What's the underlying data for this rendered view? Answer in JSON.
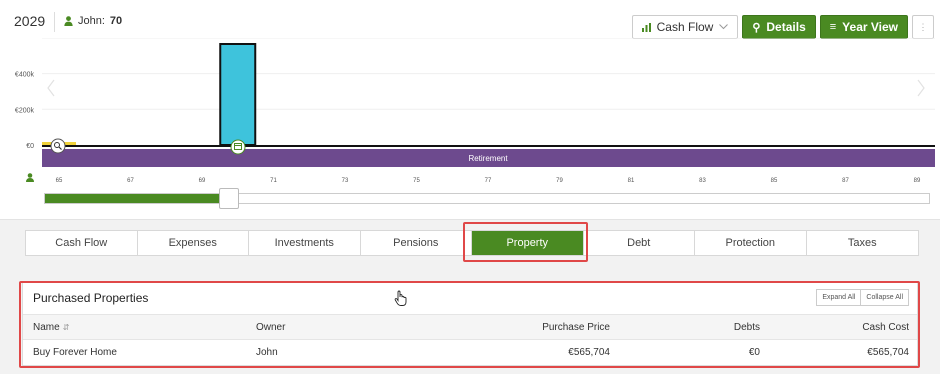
{
  "header": {
    "year": "2029",
    "person": {
      "name": "John:",
      "age": "70"
    }
  },
  "toolbar": {
    "view_select": "Cash Flow",
    "details": "Details",
    "year_view": "Year View",
    "more": "⋮"
  },
  "chart_data": {
    "type": "bar",
    "y_ticks": [
      "€400k",
      "€200k",
      "€0"
    ],
    "x_ticks": [
      "65",
      "67",
      "69",
      "71",
      "73",
      "75",
      "77",
      "79",
      "81",
      "83",
      "85",
      "87",
      "89"
    ],
    "x_range": [
      65,
      89
    ],
    "bars": [
      {
        "age": 70,
        "value": 565704,
        "color": "#3ec3dc"
      }
    ],
    "ylim": [
      0,
      565704
    ],
    "band_label": "Retirement",
    "band_color": "#6d4a8e",
    "slider_value": 70
  },
  "tabs": [
    {
      "label": "Cash Flow"
    },
    {
      "label": "Expenses"
    },
    {
      "label": "Investments"
    },
    {
      "label": "Pensions"
    },
    {
      "label": "Property",
      "active": true
    },
    {
      "label": "Debt"
    },
    {
      "label": "Protection"
    },
    {
      "label": "Taxes"
    }
  ],
  "panel": {
    "title": "Purchased Properties",
    "expand_all": "Expand All",
    "collapse_all": "Collapse All",
    "columns": {
      "name": "Name",
      "owner": "Owner",
      "purchase_price": "Purchase Price",
      "debts": "Debts",
      "cash_cost": "Cash Cost"
    },
    "rows": [
      {
        "name": "Buy Forever Home",
        "owner": "John",
        "purchase_price": "€565,704",
        "debts": "€0",
        "cash_cost": "€565,704"
      }
    ]
  }
}
